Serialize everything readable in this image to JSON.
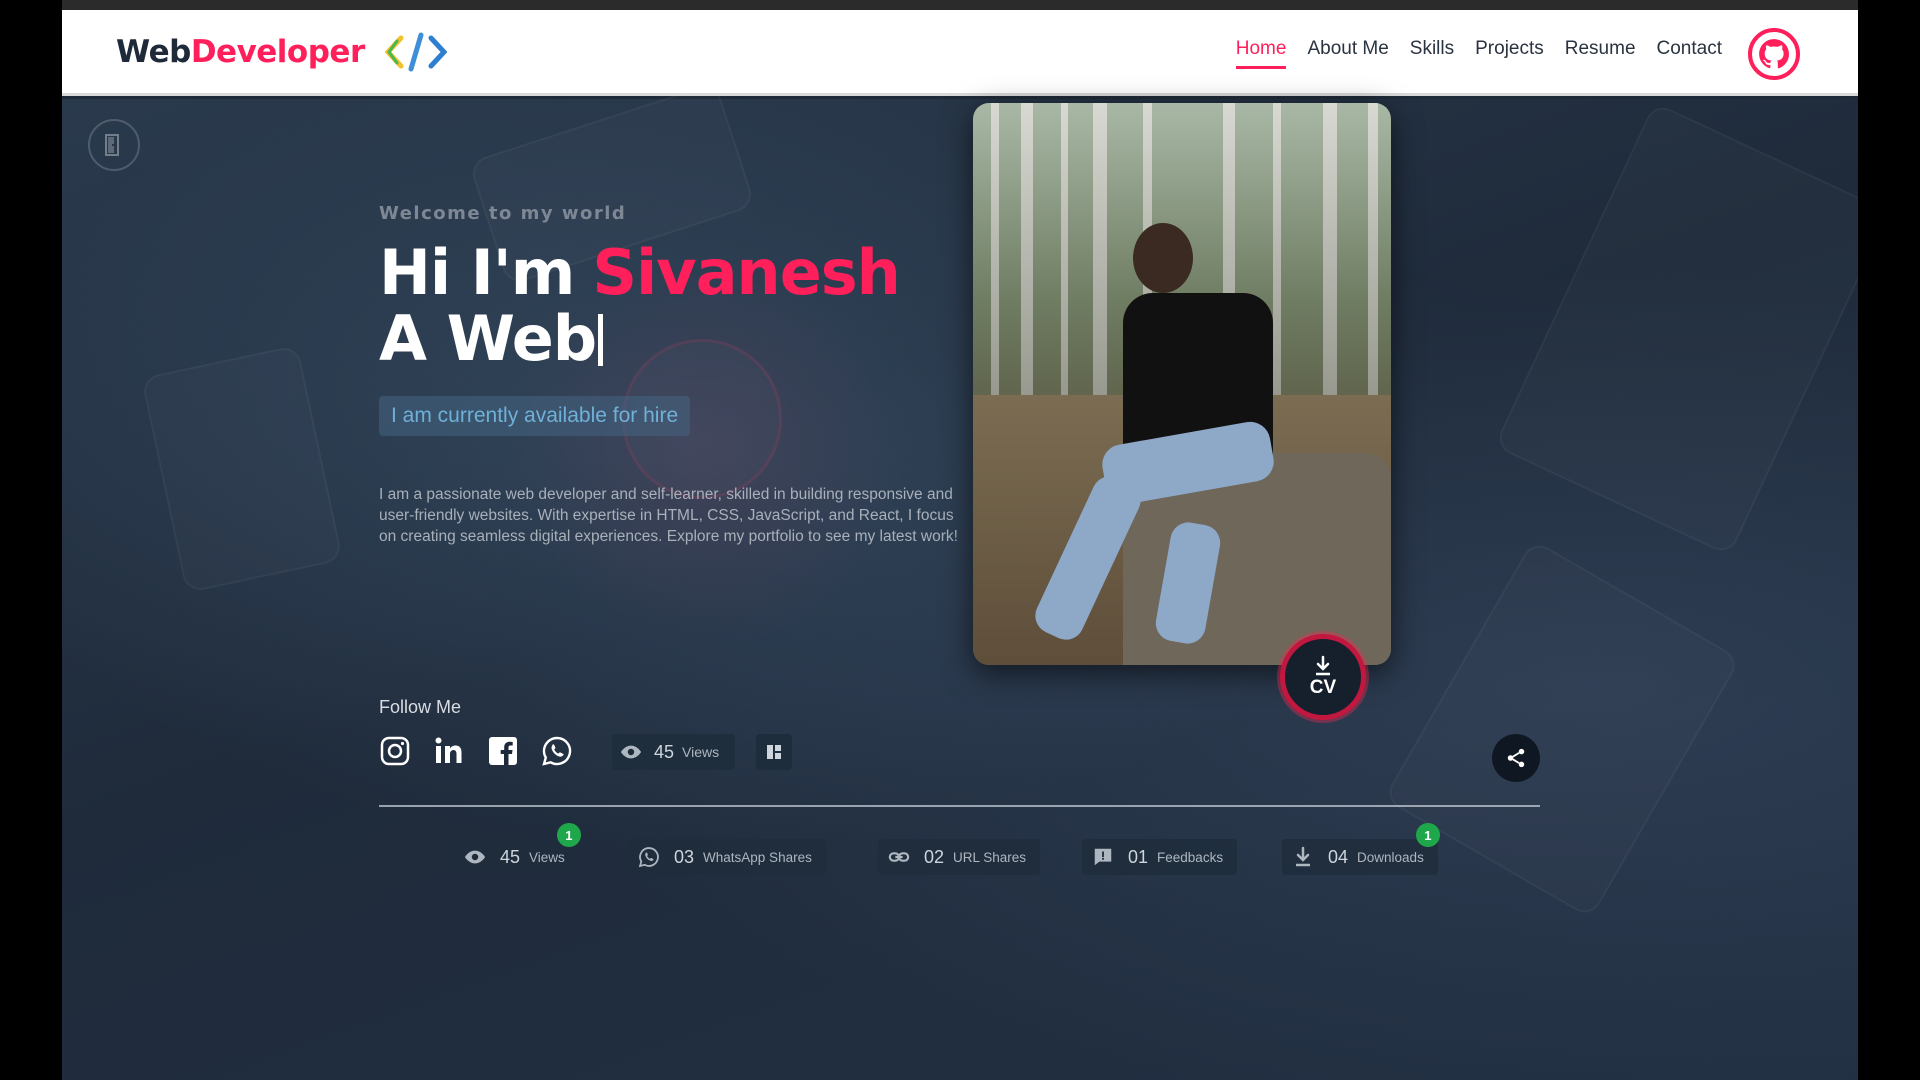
{
  "brand": {
    "part1": "Web",
    "part2": "Developer",
    "code_icon": "code-brackets-icon"
  },
  "nav": {
    "items": [
      {
        "label": "Home",
        "active": true
      },
      {
        "label": "About Me"
      },
      {
        "label": "Skills"
      },
      {
        "label": "Projects"
      },
      {
        "label": "Resume"
      },
      {
        "label": "Contact"
      }
    ]
  },
  "hero": {
    "welcome": "Welcome to my world",
    "greeting": "Hi I'm",
    "name": "Sivanesh",
    "typing": "A Web",
    "hire": "I am currently available for hire",
    "about": "I am a passionate web developer and self-learner, skilled in building responsive and user-friendly websites. With expertise in HTML, CSS, JavaScript, and React, I focus on creating seamless digital experiences. Explore my portfolio to see my latest work!",
    "cv_label": "CV"
  },
  "follow": {
    "title": "Follow Me",
    "icons": [
      "instagram-icon",
      "linkedin-icon",
      "facebook-icon",
      "whatsapp-icon"
    ],
    "views_num": "45",
    "views_label": "Views"
  },
  "stats": [
    {
      "icon": "eye-icon",
      "num": "45",
      "label": "Views",
      "badge": "1"
    },
    {
      "icon": "whatsapp-icon",
      "num": "03",
      "label": "WhatsApp Shares"
    },
    {
      "icon": "link-icon",
      "num": "02",
      "label": "URL Shares"
    },
    {
      "icon": "feedback-icon",
      "num": "01",
      "label": "Feedbacks"
    },
    {
      "icon": "download-icon",
      "num": "04",
      "label": "Downloads",
      "badge": "1"
    }
  ],
  "colors": {
    "accent": "#ff1f5a",
    "header_bg": "#ffffff",
    "hero_bg": "#1f2a38",
    "badge": "#1fa84b"
  }
}
